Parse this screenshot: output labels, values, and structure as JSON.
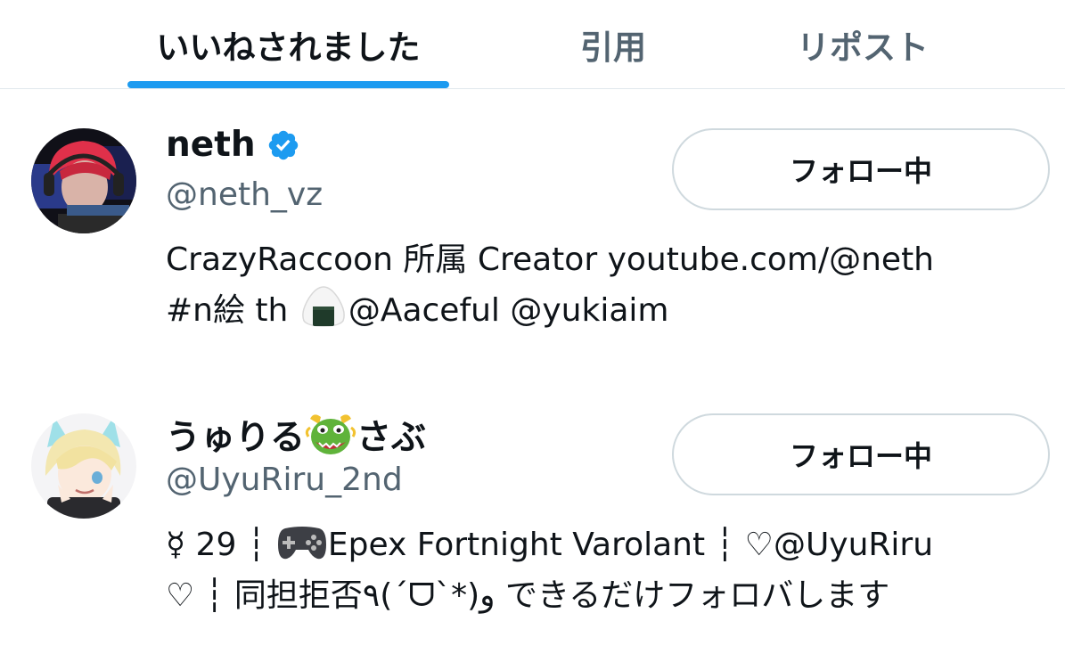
{
  "tabs": [
    {
      "label": "いいねされました",
      "active": true
    },
    {
      "label": "引用",
      "active": false
    },
    {
      "label": "リポスト",
      "active": false
    }
  ],
  "accent_color": "#1d9bf0",
  "users": [
    {
      "display_name": "neth",
      "verified": true,
      "handle": "@neth_vz",
      "follow_label": "フォロー中",
      "bio_line_1": "CrazyRaccoon 所属 Creator youtube.com/@neth",
      "bio_line_2_pre": "#n絵 th ",
      "bio_line_2_icon": "onigiri-icon",
      "bio_line_2_post": "@Aaceful @yukiaim"
    },
    {
      "display_name_pre": "うゅりる",
      "display_name_icon": "dragon-face-icon",
      "display_name_post": "さぶ",
      "handle": "@UyuRiru_2nd",
      "follow_label": "フォロー中",
      "bio_line_1_pre": "☿ 29 ┆ ",
      "bio_line_1_icon": "gamepad-icon",
      "bio_line_1_post": "Epex Fortnight Varolant ┆ ♡@UyuRiru",
      "bio_line_2": "♡ ┆ 同担拒否٩(ˊᗜˋ*)و できるだけフォロバします"
    }
  ]
}
